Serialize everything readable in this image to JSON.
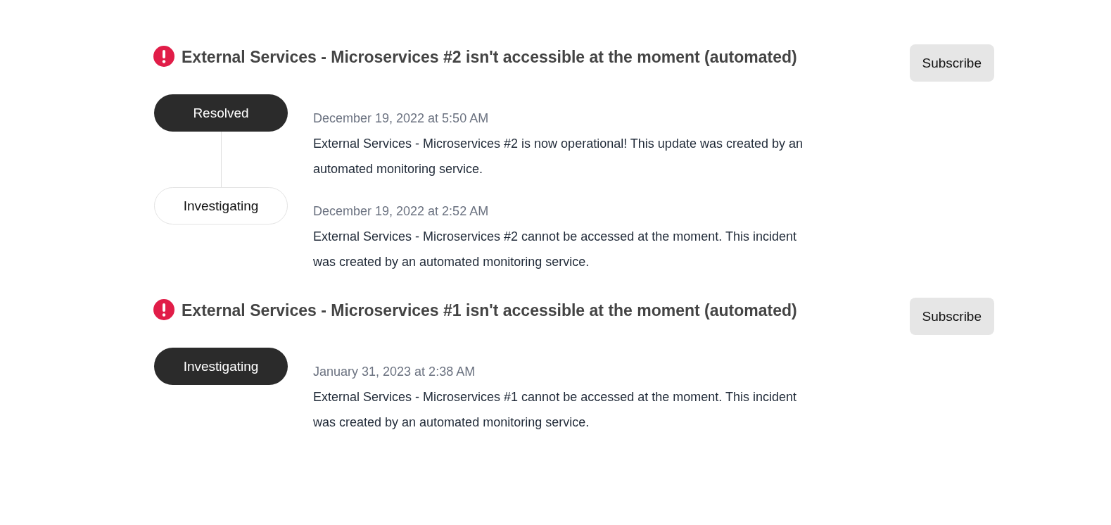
{
  "incidents": [
    {
      "title": "External Services - Microservices #2 isn't accessible at the moment (automated)",
      "subscribe": "Subscribe",
      "updates": [
        {
          "status": "Resolved",
          "current": true,
          "date": "December 19, 2022 at 5:50 AM",
          "message": "External Services - Microservices #2 is now operational! This update was created by an automated monitoring service."
        },
        {
          "status": "Investigating",
          "current": false,
          "date": "December 19, 2022 at 2:52 AM",
          "message": "External Services - Microservices #2 cannot be accessed at the moment. This incident was created by an automated monitoring service."
        }
      ]
    },
    {
      "title": "External Services - Microservices #1 isn't accessible at the moment (automated)",
      "subscribe": "Subscribe",
      "updates": [
        {
          "status": "Investigating",
          "current": true,
          "date": "January 31, 2023 at 2:38 AM",
          "message": "External Services - Microservices #1 cannot be accessed at the moment. This incident was created by an automated monitoring service."
        }
      ]
    }
  ]
}
